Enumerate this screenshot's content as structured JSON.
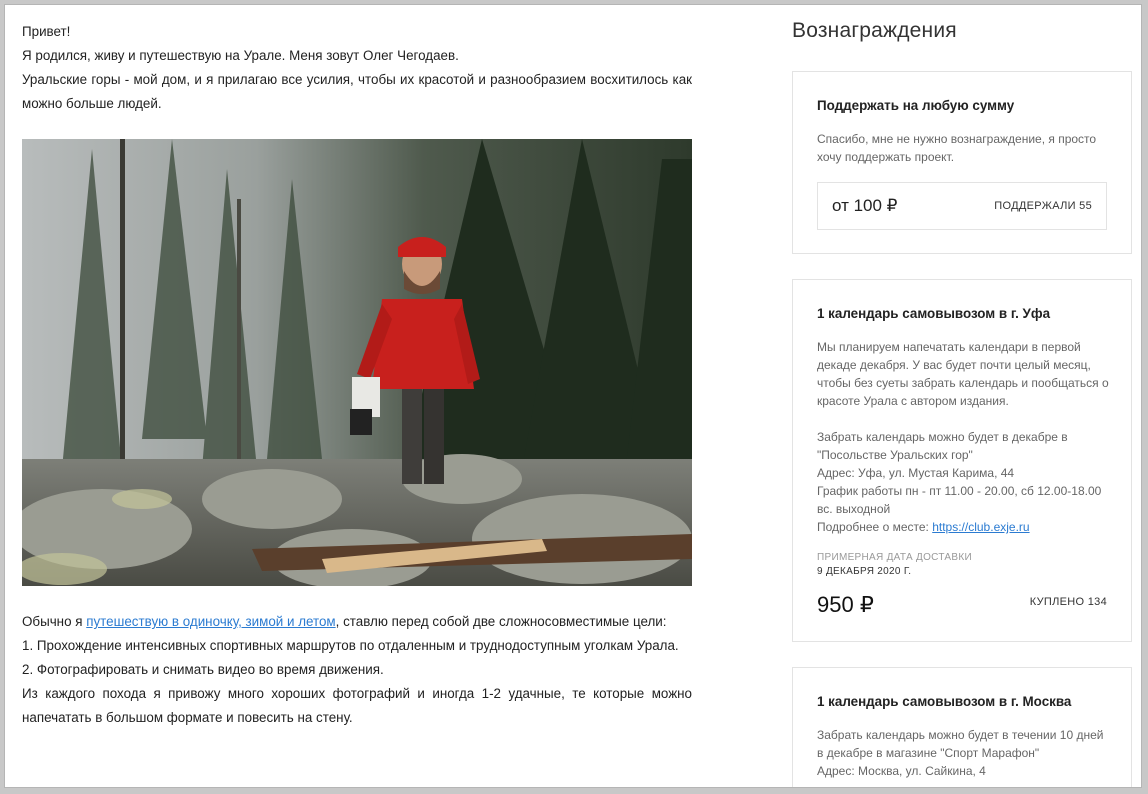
{
  "intro": {
    "line1": "Привет!",
    "line2": "Я родился, живу и путешествую на Урале. Меня зовут Олег Чегодаев.",
    "line3": "Уральские горы - мой дом, и я прилагаю все усилия, чтобы их красотой и разнообразием восхитилось как можно больше людей."
  },
  "body": {
    "para_prefix": "Обычно я ",
    "para_link": "путешествую в одиночку, зимой и летом",
    "para_suffix": ", ставлю перед собой две сложносовместимые цели:",
    "goal1": "1. Прохождение интенсивных спортивных маршрутов по отдаленным и труднодоступным уголкам Урала.",
    "goal2": "2. Фотографировать и снимать видео во время движения.",
    "closing": "Из каждого похода я привожу много хороших фотографий и иногда 1-2 удачные, те которые можно напечатать в большом формате и повесить на стену."
  },
  "rewards": {
    "title": "Вознаграждения",
    "card1": {
      "title": "Поддержать на любую сумму",
      "desc": "Спасибо, мне не нужно вознаграждение, я просто хочу поддержать проект.",
      "price": "от  100 ₽",
      "supporters": "ПОДДЕРЖАЛИ 55"
    },
    "card2": {
      "title": "1 календарь самовывозом в г. Уфа",
      "desc1": "Мы планируем напечатать календари в первой декаде декабря. У вас будет почти целый месяц, чтобы без суеты забрать календарь и пообщаться о красоте Урала с автором издания.",
      "desc2": "Забрать календарь можно будет в декабре в \"Посольстве Уральских гор\"",
      "address": "Адрес: Уфа,  ул. Мустая Карима, 44",
      "hours": "График работы пн - пт 11.00 - 20.00, сб 12.00-18.00 вс. выходной",
      "more_prefix": "Подробнее о месте: ",
      "more_link": "https://club.exje.ru",
      "delivery_label": "ПРИМЕРНАЯ ДАТА ДОСТАВКИ",
      "delivery_date": "9 ДЕКАБРЯ 2020 Г.",
      "price": "950 ₽",
      "bought": "КУПЛЕНО 134"
    },
    "card3": {
      "title": "1 календарь самовывозом в г. Москва",
      "desc1": "Забрать календарь можно будет в течении 10 дней в декабре в магазине \"Спорт Марафон\"",
      "address": "Адрес: Москва, ул. Сайкина, 4"
    }
  }
}
